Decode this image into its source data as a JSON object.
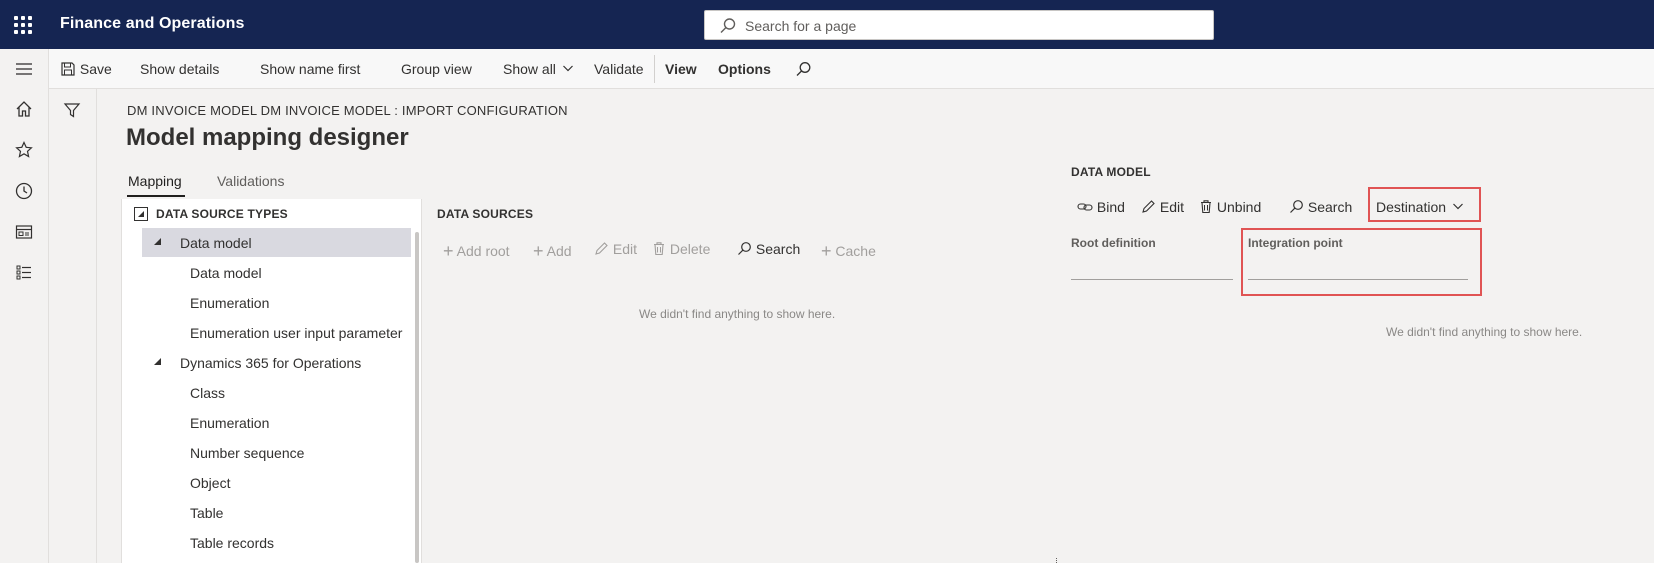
{
  "app": {
    "title": "Finance and Operations"
  },
  "search": {
    "placeholder": "Search for a page"
  },
  "actionbar": {
    "save": "Save",
    "show_details": "Show details",
    "show_name_first": "Show name first",
    "group_view": "Group view",
    "show_all": "Show all",
    "validate": "Validate",
    "view": "View",
    "options": "Options"
  },
  "header": {
    "breadcrumb": "DM INVOICE MODEL DM INVOICE MODEL : IMPORT CONFIGURATION",
    "title": "Model mapping designer"
  },
  "tabs": [
    {
      "label": "Mapping",
      "active": true
    },
    {
      "label": "Validations",
      "active": false
    }
  ],
  "tree": {
    "root": "DATA SOURCE TYPES",
    "items": [
      {
        "label": "Data model",
        "level": 1,
        "expanded": true,
        "selected": true
      },
      {
        "label": "Data model",
        "level": 2
      },
      {
        "label": "Enumeration",
        "level": 2
      },
      {
        "label": "Enumeration user input parameter",
        "level": 2
      },
      {
        "label": "Dynamics 365 for Operations",
        "level": 1,
        "expanded": true
      },
      {
        "label": "Class",
        "level": 2
      },
      {
        "label": "Enumeration",
        "level": 2
      },
      {
        "label": "Number sequence",
        "level": 2
      },
      {
        "label": "Object",
        "level": 2
      },
      {
        "label": "Table",
        "level": 2
      },
      {
        "label": "Table records",
        "level": 2
      }
    ]
  },
  "data_sources": {
    "title": "DATA SOURCES",
    "actions": {
      "add_root": "Add root",
      "add": "Add",
      "edit": "Edit",
      "delete": "Delete",
      "search": "Search",
      "cache": "Cache"
    },
    "empty": "We didn't find anything to show here."
  },
  "data_model": {
    "title": "DATA MODEL",
    "actions": {
      "bind": "Bind",
      "edit": "Edit",
      "unbind": "Unbind",
      "search": "Search",
      "destination": "Destination"
    },
    "root_definition_label": "Root definition",
    "integration_point_label": "Integration point",
    "empty": "We didn't find anything to show here."
  },
  "colors": {
    "topbar": "#152552",
    "highlight": "#e05454",
    "selected_row": "#d9d9e0"
  }
}
